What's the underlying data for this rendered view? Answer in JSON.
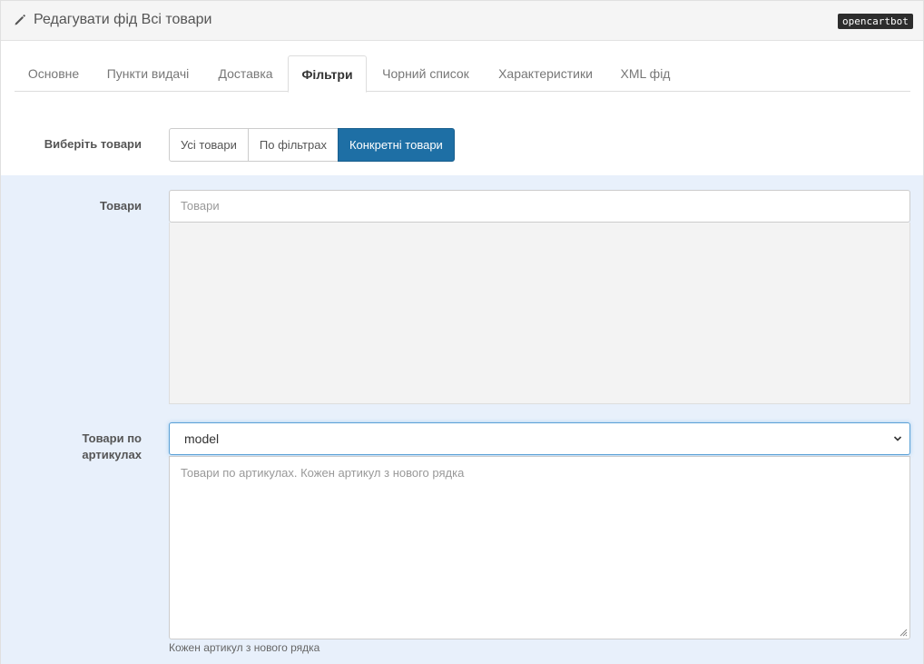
{
  "header": {
    "title": "Редагувати фід Всі товари",
    "title_icon": "pencil-icon",
    "brand_badge": "opencartbot"
  },
  "tabs": [
    {
      "label": "Основне",
      "active": false
    },
    {
      "label": "Пункти видачі",
      "active": false
    },
    {
      "label": "Доставка",
      "active": false
    },
    {
      "label": "Фільтри",
      "active": true
    },
    {
      "label": "Чорний список",
      "active": false
    },
    {
      "label": "Характеристики",
      "active": false
    },
    {
      "label": "XML фід",
      "active": false
    }
  ],
  "select_products": {
    "label": "Виберіть товари",
    "options": [
      {
        "label": "Усі товари",
        "active": false
      },
      {
        "label": "По фільтрах",
        "active": false
      },
      {
        "label": "Конкретні товари",
        "active": true
      }
    ]
  },
  "products": {
    "label": "Товари",
    "placeholder": "Товари",
    "value": ""
  },
  "products_by_sku": {
    "label_line1": "Товари по",
    "label_line2": "артикулах",
    "select_value": "model",
    "textarea_placeholder": "Товари по артикулах. Кожен артикул з нового рядка",
    "help_text": "Кожен артикул з нового рядка"
  },
  "colors": {
    "accent": "#1e6fa5",
    "section_background": "#e8f0fb",
    "focus_border": "#5aa0d6"
  }
}
